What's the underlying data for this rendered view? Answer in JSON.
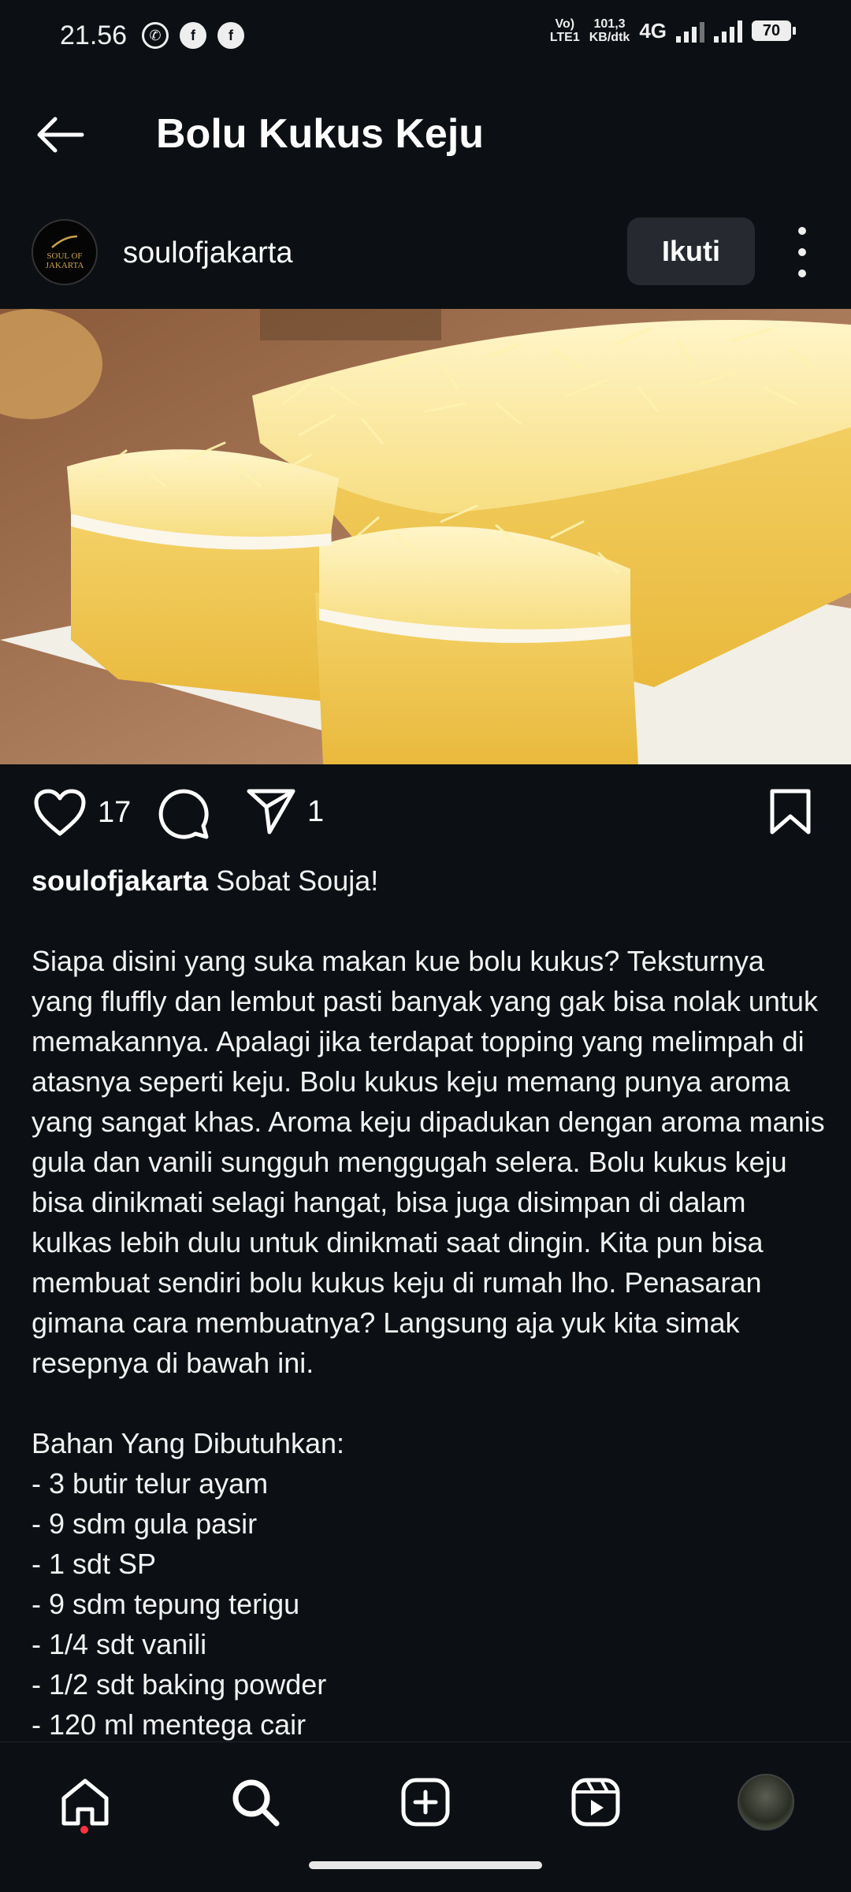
{
  "status_bar": {
    "time": "21.56",
    "volte_top": "Vo)",
    "volte_bottom": "LTE1",
    "speed_value": "101,3",
    "speed_unit": "KB/dtk",
    "network": "4G",
    "battery": "70",
    "app_icons": [
      "whatsapp-icon",
      "facebook-icon",
      "facebook-icon"
    ]
  },
  "header": {
    "title": "Bolu Kukus Keju"
  },
  "author": {
    "avatar_text_top": "SOUL OF",
    "avatar_text_bottom": "JAKARTA",
    "username": "soulofjakarta",
    "follow_label": "Ikuti"
  },
  "actions": {
    "likes": "17",
    "shares": "1"
  },
  "caption": {
    "username": "soulofjakarta",
    "first_line": " Sobat Souja!",
    "paragraph": "Siapa disini yang suka makan kue bolu kukus? Teksturnya yang fluffly dan lembut pasti banyak yang gak bisa nolak untuk memakannya. Apalagi jika terdapat topping yang melimpah di atasnya seperti keju. Bolu kukus keju memang punya aroma yang sangat khas. Aroma keju dipadukan dengan aroma manis gula dan vanili sungguh menggugah selera. Bolu kukus keju bisa dinikmati selagi hangat, bisa juga disimpan di dalam kulkas lebih dulu untuk dinikmati saat dingin. Kita pun bisa membuat sendiri bolu kukus keju di rumah lho. Penasaran gimana cara membuatnya? Langsung aja yuk kita simak resepnya di bawah ini.",
    "ingredients_title": "Bahan Yang Dibutuhkan:",
    "ingredients": [
      "- 3 butir telur ayam",
      "- 9 sdm gula pasir",
      "- 1 sdt SP",
      "- 9 sdm tepung terigu",
      "- 1/4 sdt vanili",
      "- 1/2 sdt baking powder",
      "- 120 ml mentega cair"
    ]
  },
  "bottom_nav": {
    "items": [
      "home-icon",
      "search-icon",
      "create-icon",
      "reels-icon",
      "profile-avatar"
    ]
  },
  "colors": {
    "background": "#0c1014",
    "button": "#262a30",
    "notification_dot": "#ff3040"
  }
}
